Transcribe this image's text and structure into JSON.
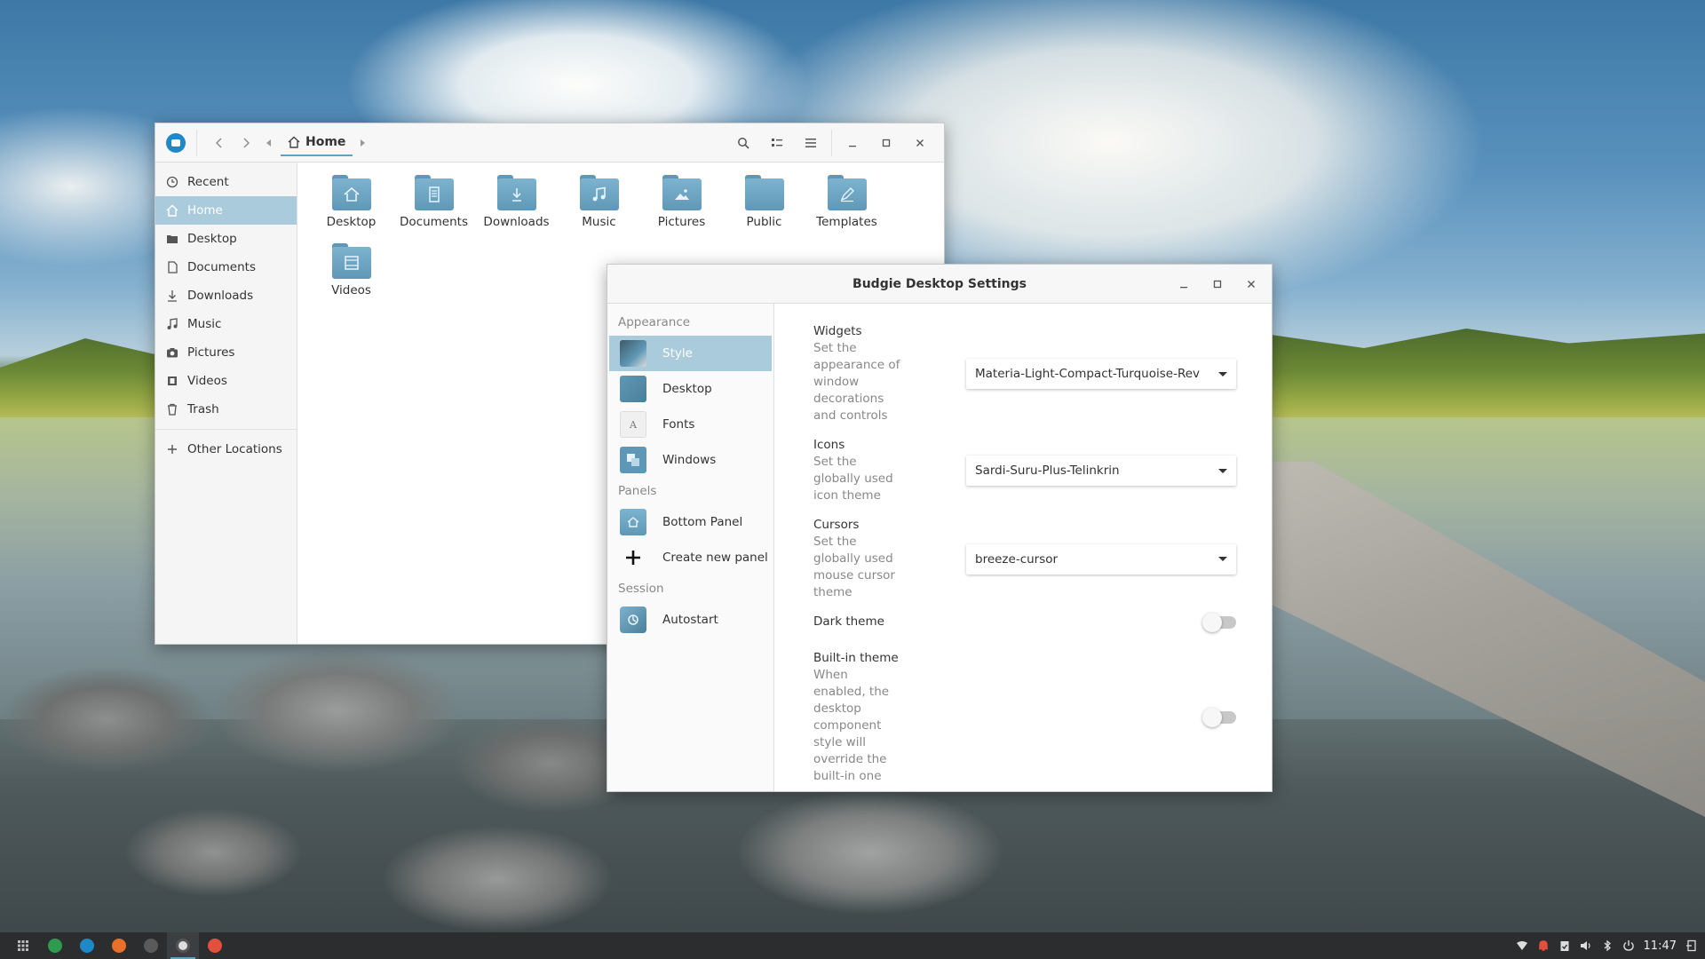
{
  "file_manager": {
    "breadcrumb": "Home",
    "sidebar": [
      {
        "label": "Recent",
        "icon": "clock-icon"
      },
      {
        "label": "Home",
        "icon": "home-icon",
        "active": true
      },
      {
        "label": "Desktop",
        "icon": "desktop-folder-icon"
      },
      {
        "label": "Documents",
        "icon": "document-icon"
      },
      {
        "label": "Downloads",
        "icon": "download-icon"
      },
      {
        "label": "Music",
        "icon": "music-icon"
      },
      {
        "label": "Pictures",
        "icon": "camera-icon"
      },
      {
        "label": "Videos",
        "icon": "film-icon"
      },
      {
        "label": "Trash",
        "icon": "trash-icon"
      },
      {
        "label": "Other Locations",
        "icon": "plus-icon"
      }
    ],
    "folders": [
      {
        "label": "Desktop",
        "icon": "home-glyph"
      },
      {
        "label": "Documents",
        "icon": "document-glyph"
      },
      {
        "label": "Downloads",
        "icon": "download-glyph"
      },
      {
        "label": "Music",
        "icon": "music-glyph"
      },
      {
        "label": "Pictures",
        "icon": "picture-glyph"
      },
      {
        "label": "Public",
        "icon": "none"
      },
      {
        "label": "Templates",
        "icon": "pen-glyph"
      },
      {
        "label": "Videos",
        "icon": "film-glyph"
      }
    ]
  },
  "settings": {
    "title": "Budgie Desktop Settings",
    "sections": {
      "appearance": "Appearance",
      "panels": "Panels",
      "session": "Session"
    },
    "nav": {
      "style": "Style",
      "desktop": "Desktop",
      "fonts": "Fonts",
      "windows": "Windows",
      "bottom_panel": "Bottom Panel",
      "create_panel": "Create new panel",
      "autostart": "Autostart"
    },
    "fonts_icon_glyph": "A",
    "rows": {
      "widgets": {
        "title": "Widgets",
        "desc": "Set the appearance of window decorations and controls",
        "value": "Materia-Light-Compact-Turquoise-Rev"
      },
      "icons": {
        "title": "Icons",
        "desc": "Set the globally used icon theme",
        "value": "Sardi-Suru-Plus-Telinkrin"
      },
      "cursors": {
        "title": "Cursors",
        "desc": "Set the globally used mouse cursor theme",
        "value": "breeze-cursor"
      },
      "dark_theme": {
        "title": "Dark theme",
        "enabled": false
      },
      "builtin_theme": {
        "title": "Built-in theme",
        "desc": "When enabled, the desktop component style will override the built-in one",
        "enabled": false
      }
    }
  },
  "taskbar": {
    "clock": "11:47"
  },
  "colors": {
    "accent": "#5fa2c4",
    "selection": "#a9cbdc",
    "folder": "#5f98b6",
    "taskbar": "#2b2d2f"
  }
}
